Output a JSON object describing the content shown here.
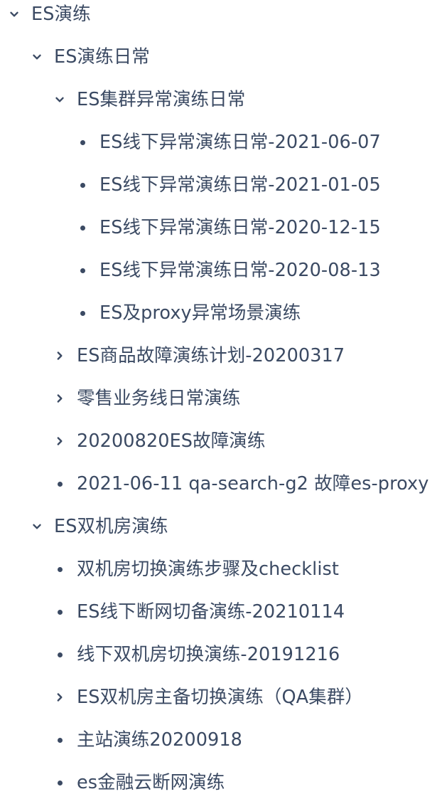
{
  "tree": {
    "items": [
      {
        "label": "ES演练",
        "icon": "chevron-down-icon"
      },
      {
        "label": "ES演练日常",
        "icon": "chevron-down-icon"
      },
      {
        "label": "ES集群异常演练日常",
        "icon": "chevron-down-icon"
      },
      {
        "label": "ES线下异常演练日常-2021-06-07",
        "icon": "bullet-icon"
      },
      {
        "label": "ES线下异常演练日常-2021-01-05",
        "icon": "bullet-icon"
      },
      {
        "label": "ES线下异常演练日常-2020-12-15",
        "icon": "bullet-icon"
      },
      {
        "label": "ES线下异常演练日常-2020-08-13",
        "icon": "bullet-icon"
      },
      {
        "label": "ES及proxy异常场景演练",
        "icon": "bullet-icon"
      },
      {
        "label": "ES商品故障演练计划-20200317",
        "icon": "chevron-right-icon"
      },
      {
        "label": "零售业务线日常演练",
        "icon": "chevron-right-icon"
      },
      {
        "label": "20200820ES故障演练",
        "icon": "chevron-right-icon"
      },
      {
        "label": "2021-06-11 qa-search-g2 故障es-proxy",
        "icon": "bullet-icon"
      },
      {
        "label": "ES双机房演练",
        "icon": "chevron-down-icon"
      },
      {
        "label": "双机房切换演练步骤及checklist",
        "icon": "bullet-icon"
      },
      {
        "label": "ES线下断网切备演练-20210114",
        "icon": "bullet-icon"
      },
      {
        "label": "线下双机房切换演练-20191216",
        "icon": "bullet-icon"
      },
      {
        "label": "ES双机房主备切换演练（QA集群）",
        "icon": "chevron-right-icon"
      },
      {
        "label": "主站演练20200918",
        "icon": "bullet-icon"
      },
      {
        "label": "es金融云断网演练",
        "icon": "bullet-icon"
      }
    ]
  },
  "colors": {
    "text": "#3b4a63",
    "background": "#ffffff"
  }
}
